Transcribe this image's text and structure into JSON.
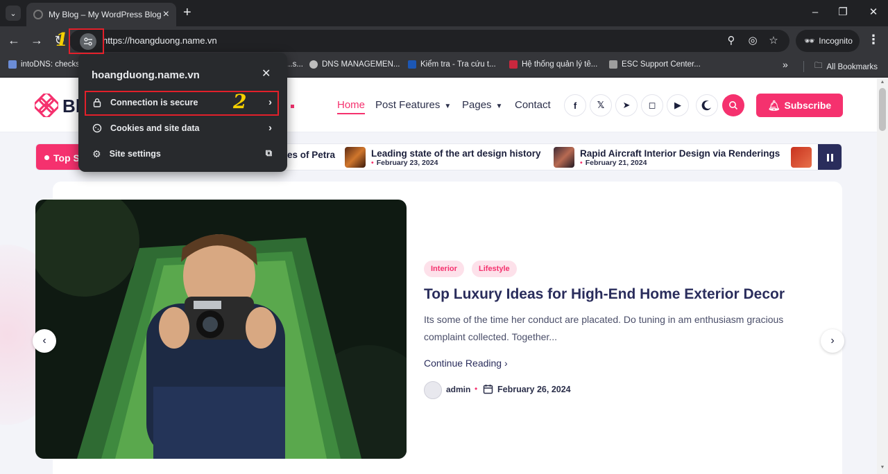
{
  "browser": {
    "tab_title": "My Blog – My WordPress Blog",
    "url": "https://hoangduong.name.vn",
    "incognito_label": "Incognito",
    "bookmarks": [
      {
        "label": "intoDNS: checks..."
      },
      {
        "label": "...s..."
      },
      {
        "label": "DNS MANAGEMEN..."
      },
      {
        "label": "Kiểm tra - Tra cứu t..."
      },
      {
        "label": "Hệ thống quản lý tê..."
      },
      {
        "label": "ESC Support Center..."
      }
    ],
    "all_bookmarks_label": "All Bookmarks"
  },
  "site_info_popup": {
    "domain": "hoangduong.name.vn",
    "rows": [
      {
        "label": "Connection is secure",
        "icon": "lock-icon"
      },
      {
        "label": "Cookies and site data",
        "icon": "cookie-icon"
      },
      {
        "label": "Site settings",
        "icon": "gear-icon"
      }
    ]
  },
  "annotations": {
    "step1": "1",
    "step2": "2",
    "color": "#e3202a",
    "number_color": "#f5d000"
  },
  "site": {
    "logo_text": "Bl",
    "nav": [
      {
        "label": "Home",
        "active": true
      },
      {
        "label": "Post Features",
        "has_dropdown": true
      },
      {
        "label": "Pages",
        "has_dropdown": true
      },
      {
        "label": "Contact"
      }
    ],
    "social_icons": [
      "facebook-icon",
      "x-icon",
      "telegram-icon",
      "instagram-icon",
      "youtube-icon"
    ],
    "subscribe_label": "Subscribe",
    "accent_color": "#f5316e"
  },
  "ticker": {
    "label": "Top S",
    "items": [
      {
        "title": "es of Petra"
      },
      {
        "title": "Leading state of the art design history",
        "date": "February 23, 2024"
      },
      {
        "title": "Rapid Aircraft Interior Design via Renderings",
        "date": "February 21, 2024"
      }
    ]
  },
  "featured_post": {
    "tags": [
      "Interior",
      "Lifestyle"
    ],
    "title": "Top Luxury Ideas for High-End Home Exterior Decor",
    "excerpt": "Its some of the time her conduct are placated. Do tuning in am enthusiasm gracious complaint collected. Together...",
    "continue_label": "Continue Reading",
    "author": "admin",
    "date": "February 26, 2024"
  }
}
